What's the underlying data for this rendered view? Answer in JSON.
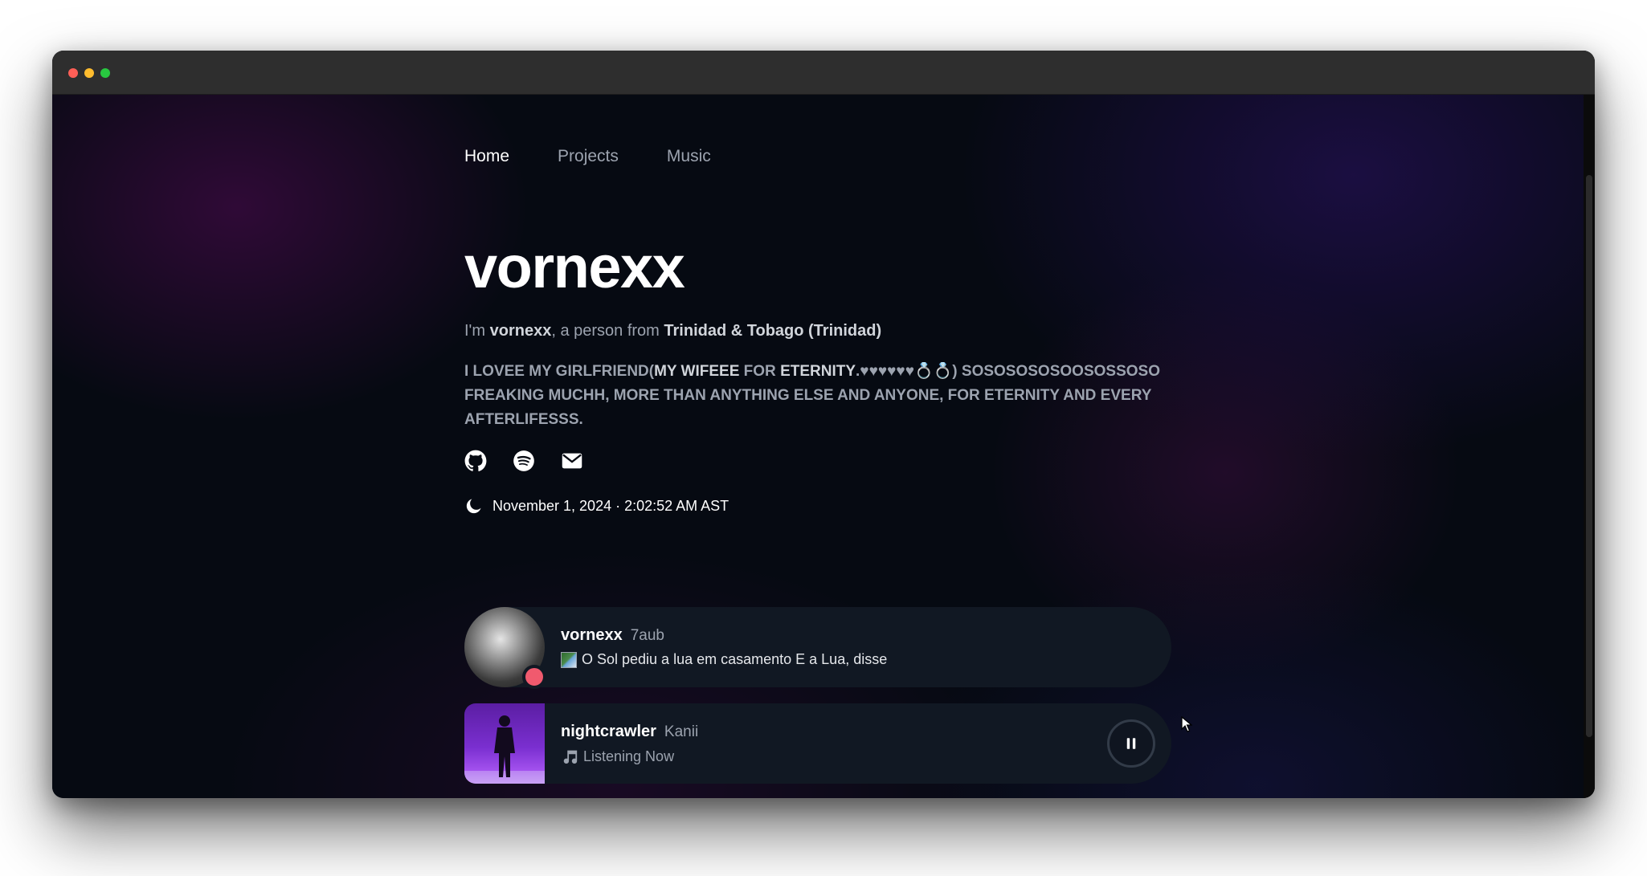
{
  "nav": {
    "items": [
      {
        "label": "Home",
        "active": true
      },
      {
        "label": "Projects",
        "active": false
      },
      {
        "label": "Music",
        "active": false
      }
    ]
  },
  "hero": {
    "title": "vornexx",
    "intro": {
      "prefix": "I'm",
      "name": "vornexx",
      "middle": ", a person from",
      "location": "Trinidad & Tobago (Trinidad)"
    },
    "bio": {
      "part1": "I LOVEE MY GIRLFRIEND(",
      "emph1": "MY WIFEEE",
      "part2": " FOR ",
      "emph2": "ETERNITY",
      "part3": ".♥♥♥♥♥♥💍💍)",
      "part4": "SOSOSOSOSOOSOSSOSO FREAKING MUCHH, MORE THAN ANYTHING ELSE AND ANYONE, FOR ETERNITY AND EVERY AFTERLIFESSS."
    }
  },
  "socials": [
    {
      "icon": "github-icon"
    },
    {
      "icon": "spotify-icon"
    },
    {
      "icon": "mail-icon"
    }
  ],
  "datetime": {
    "icon": "moon-icon",
    "text": "November 1, 2024 · 2:02:52 AM AST"
  },
  "discord_card": {
    "username": "vornexx",
    "tag": "7aub",
    "status_text": "O Sol pediu a lua em casamento E a Lua, disse",
    "status_color": "#f05a6e"
  },
  "music_card": {
    "track": "nightcrawler",
    "artist": "Kanii",
    "status": "Listening Now",
    "button_icon": "pause-icon"
  },
  "colors": {
    "background": "#060a12",
    "card": "#111823",
    "text_primary": "#ffffff",
    "text_muted": "#9ca3af",
    "album_accent": "#7a2fd0"
  }
}
